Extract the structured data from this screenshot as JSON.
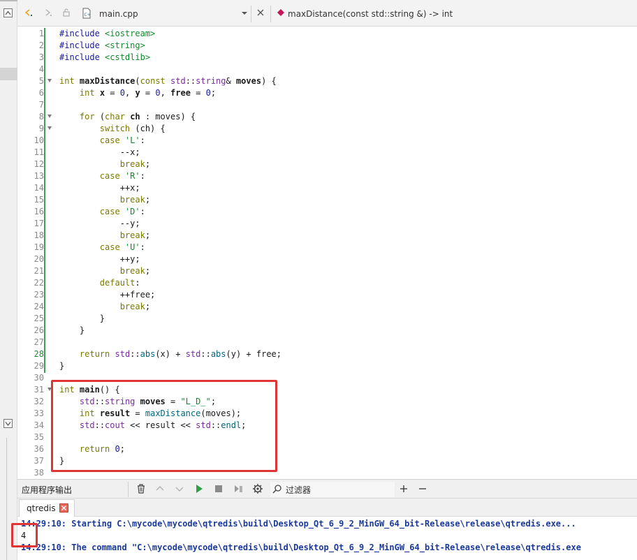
{
  "toolbar": {
    "file_name": "main.cpp",
    "function_signature": "maxDistance(const std::string &) -> int"
  },
  "editor": {
    "line_numbers": [
      "1",
      "2",
      "3",
      "4",
      "5",
      "6",
      "7",
      "8",
      "9",
      "10",
      "11",
      "12",
      "13",
      "14",
      "15",
      "16",
      "17",
      "18",
      "19",
      "20",
      "21",
      "22",
      "23",
      "24",
      "25",
      "26",
      "27",
      "28",
      "29",
      "30",
      "31",
      "32",
      "33",
      "34",
      "35",
      "36",
      "37",
      "38"
    ],
    "current_line": "28",
    "code": {
      "l1": {
        "a": "#include ",
        "b": "<iostream>"
      },
      "l2": {
        "a": "#include ",
        "b": "<string>"
      },
      "l3": {
        "a": "#include ",
        "b": "<cstdlib>"
      },
      "l5": {
        "int": "int",
        "name": "maxDistance",
        "p1": "(",
        "const": "const",
        "std": "std",
        "sep": "::",
        "string": "string",
        "amp": "& ",
        "moves": "moves",
        "p2": ") {"
      },
      "l6": {
        "int": "int",
        "x": "x",
        "eq1": " = ",
        "z1": "0",
        "c1": ", ",
        "y": "y",
        "eq2": " = ",
        "z2": "0",
        "c2": ", ",
        "free": "free",
        "eq3": " = ",
        "z3": "0",
        "end": ";"
      },
      "l8": {
        "for": "for",
        "p1": " (",
        "char": "char",
        "ch": "ch",
        "rest": " : moves) {"
      },
      "l9": {
        "switch": "switch",
        "rest": " (ch) {"
      },
      "l10": {
        "case": "case",
        "val": "'L'",
        "colon": ":"
      },
      "l11": {
        "text": "--x;"
      },
      "l12": {
        "brk": "break",
        "end": ";"
      },
      "l13": {
        "case": "case",
        "val": "'R'",
        "colon": ":"
      },
      "l14": {
        "text": "++x;"
      },
      "l15": {
        "brk": "break",
        "end": ";"
      },
      "l16": {
        "case": "case",
        "val": "'D'",
        "colon": ":"
      },
      "l17": {
        "text": "--y;"
      },
      "l18": {
        "brk": "break",
        "end": ";"
      },
      "l19": {
        "case": "case",
        "val": "'U'",
        "colon": ":"
      },
      "l20": {
        "text": "++y;"
      },
      "l21": {
        "brk": "break",
        "end": ";"
      },
      "l22": {
        "def": "default",
        "colon": ":"
      },
      "l23": {
        "text": "++free;"
      },
      "l24": {
        "brk": "break",
        "end": ";"
      },
      "l25": {
        "text": "}"
      },
      "l26": {
        "text": "}"
      },
      "l28": {
        "ret": "return",
        "s1": "std",
        "sep1": "::",
        "abs1": "abs",
        "a1": "(x) + ",
        "s2": "std",
        "sep2": "::",
        "abs2": "abs",
        "a2": "(y) + free;"
      },
      "l29": {
        "text": "}"
      },
      "l31": {
        "int": "int",
        "main": "main",
        "rest": "() {"
      },
      "l32": {
        "std": "std",
        "sep": "::",
        "string": "string",
        "moves": "moves",
        "eq": " = ",
        "str": "\"L_D_\"",
        "end": ";"
      },
      "l33": {
        "int": "int",
        "result": "result",
        "eq": " = ",
        "call": "maxDistance",
        "rest": "(moves);"
      },
      "l34": {
        "s1": "std",
        "sep1": "::",
        "cout": "cout",
        "o1": " << ",
        "result": "result",
        "o2": " << ",
        "s2": "std",
        "sep2": "::",
        "endl": "endl",
        "end": ";"
      },
      "l36": {
        "ret": "return",
        "zero": "0",
        "end": ";"
      },
      "l37": {
        "text": "}"
      }
    }
  },
  "output_pane": {
    "title": "应用程序输出",
    "filter_placeholder": "过滤器",
    "tab_label": "qtredis",
    "lines": [
      "14:29:10: Starting C:\\mycode\\mycode\\qtredis\\build\\Desktop_Qt_6_9_2_MinGW_64_bit-Release\\release\\qtredis.exe...",
      "4",
      "14:29:10: The command \"C:\\mycode\\mycode\\qtredis\\build\\Desktop_Qt_6_9_2_MinGW_64_bit-Release\\release\\qtredis.exe"
    ]
  },
  "colors": {
    "highlight_box": "#e03535",
    "change_bar": "#3aa052",
    "output_blue": "#1a3a9a"
  },
  "icons": [
    "back-icon",
    "forward-icon",
    "lock-icon",
    "file-icon",
    "dropdown-icon",
    "close-icon",
    "function-icon",
    "clear-icon",
    "up-icon",
    "down-icon",
    "run-icon",
    "stop-icon",
    "attach-icon",
    "gear-icon",
    "search-icon",
    "add-icon",
    "remove-icon",
    "tab-close-icon"
  ]
}
